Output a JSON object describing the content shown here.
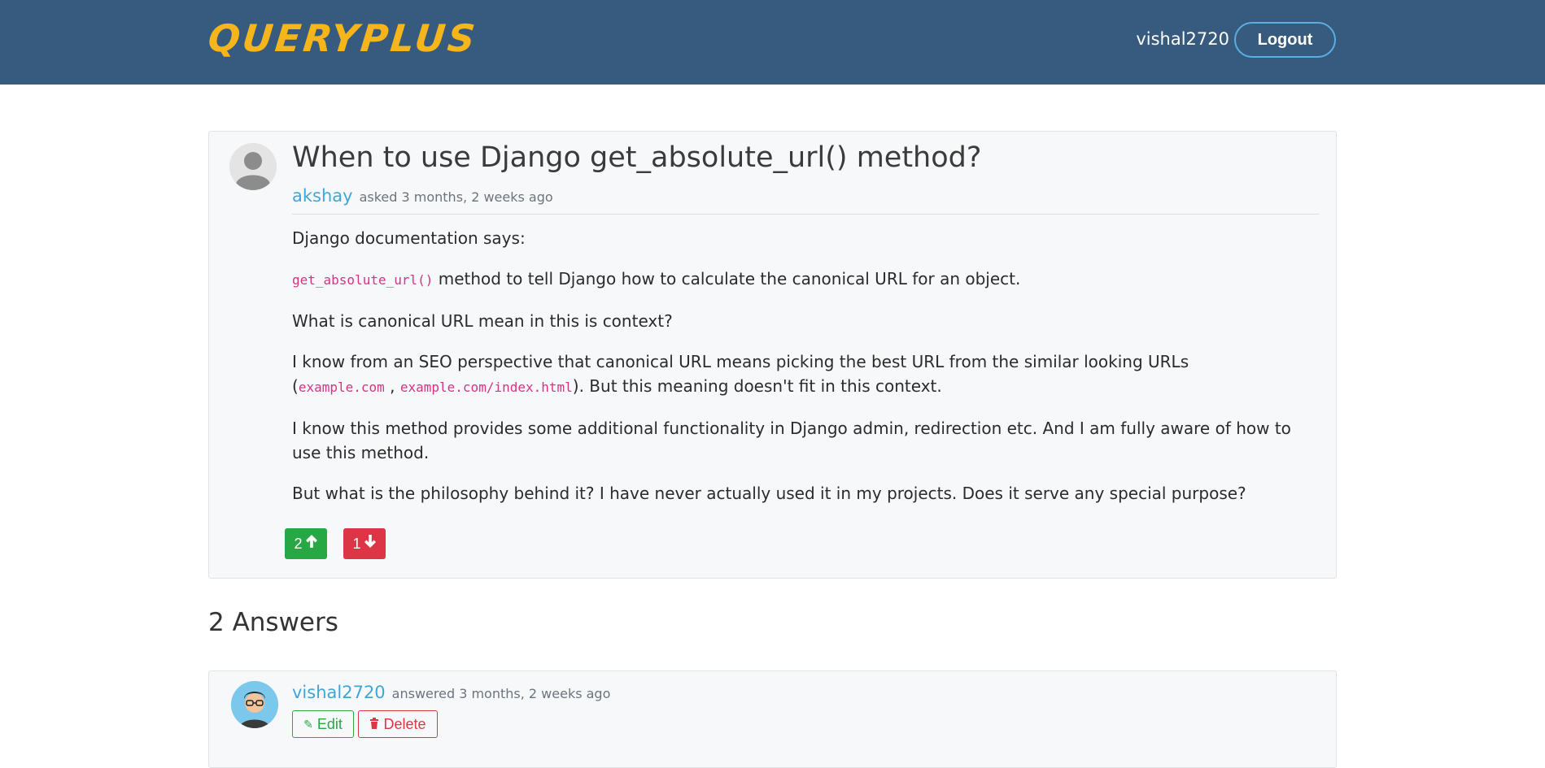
{
  "navbar": {
    "brand": "QUERYPLUS",
    "username": "vishal2720",
    "logout_label": "Logout"
  },
  "question": {
    "title": "When to use Django get_absolute_url() method?",
    "author": "akshay",
    "asked_text": "asked 3 months, 2 weeks ago",
    "body": {
      "p1": "Django documentation says:",
      "p2_code": "get_absolute_url()",
      "p2_text": " method to tell Django how to calculate the canonical URL for an object.",
      "p3": "What is canonical URL mean in this is context?",
      "p4_text1": "I know from an SEO perspective that canonical URL means picking the best URL from the similar looking URLs (",
      "p4_code1": "example.com",
      "p4_sep": " , ",
      "p4_code2": "example.com/index.html",
      "p4_text2": "). But this meaning doesn't fit in this context.",
      "p5": "I know this method provides some additional functionality in Django admin, redirection etc. And I am fully aware of how to use this method.",
      "p6": "But what is the philosophy behind it? I have never actually used it in my projects. Does it serve any special purpose?"
    },
    "upvotes": "2",
    "downvotes": "1",
    "upvote_icon": "arrow-up-icon",
    "downvote_icon": "arrow-down-icon"
  },
  "answers": {
    "heading": "2 Answers",
    "items": [
      {
        "author": "vishal2720",
        "answered_text": "answered 3 months, 2 weeks ago",
        "edit_label": "Edit",
        "delete_label": "Delete"
      }
    ]
  },
  "colors": {
    "navbar": "#375a7f",
    "brand": "#f5b51b",
    "link": "#3fa7d6",
    "upvote": "#28a745",
    "downvote": "#dc3545",
    "code": "#d63384"
  }
}
